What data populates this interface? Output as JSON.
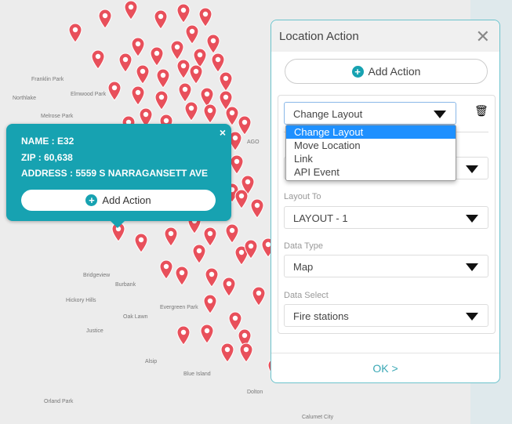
{
  "map": {
    "places": [
      "Franklin Park",
      "Northlake",
      "Elmwood Park",
      "Melrose Park",
      "Bridgeview",
      "Burbank",
      "Hickory Hills",
      "Oak Lawn",
      "Evergreen Park",
      "Justice",
      "Alsip",
      "Blue Island",
      "Dolton",
      "Orland Park",
      "Calumet City",
      "AGO"
    ],
    "marker_color": "#e8505b",
    "lake_color": "#d8e6ea"
  },
  "popup": {
    "name": "NAME : E32",
    "zip": "ZIP : 60,638",
    "address": "ADDRESS : 5559 S NARRAGANSETT AVE",
    "add_action": "Add Action",
    "close": "×"
  },
  "panel": {
    "title": "Location Action",
    "close": "✕",
    "add_action": "Add Action",
    "action_type": {
      "value": "Change Layout",
      "options": [
        "Change Layout",
        "Move Location",
        "Link",
        "API Event"
      ],
      "highlighted": "Change Layout"
    },
    "layout_to": {
      "label": "Layout To",
      "value": "LAYOUT - 1"
    },
    "data_type": {
      "label": "Data Type",
      "value": "Map"
    },
    "data_select": {
      "label": "Data Select",
      "value": "Fire stations"
    },
    "ok": "OK >"
  },
  "colors": {
    "accent": "#17a2b1",
    "highlight": "#1e90ff"
  }
}
